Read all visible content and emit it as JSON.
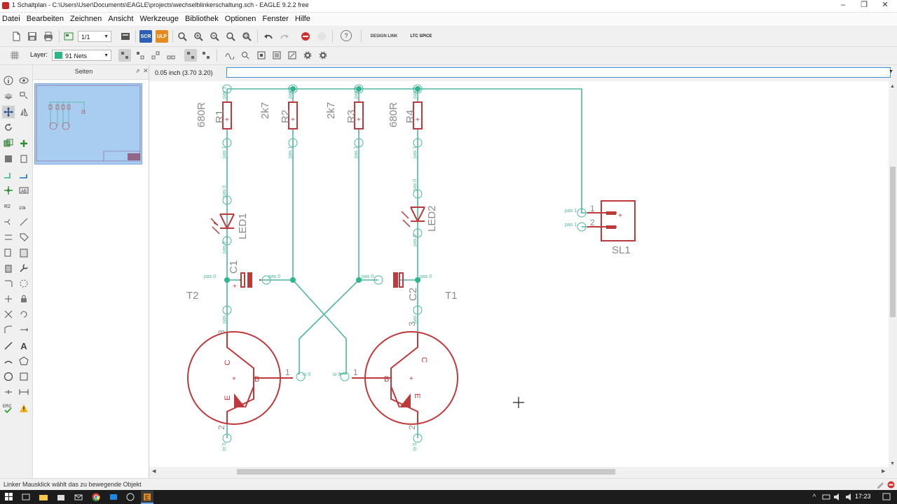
{
  "window": {
    "title": "1 Schaltplan - C:\\Users\\User\\Documents\\EAGLE\\projects\\wechselblinkerschaltung.sch - EAGLE 9.2.2 free",
    "minimize": "–",
    "maximize": "❐",
    "close": "✕"
  },
  "menu": [
    "Datei",
    "Bearbeiten",
    "Zeichnen",
    "Ansicht",
    "Werkzeuge",
    "Bibliothek",
    "Optionen",
    "Fenster",
    "Hilfe"
  ],
  "toolbar": {
    "sheet_combo": "1/1",
    "scr_label": "SCR",
    "ulp_label": "ULP",
    "help_label": "?",
    "designlink_label": "DESIGN LINK",
    "ltspice_label": "LTC SPICE",
    "layer_label": "Layer:",
    "layer_value": "91 Nets",
    "layer_color": "#2fb58a"
  },
  "pages_panel": {
    "title": "Seiten"
  },
  "coordinates": "0.05 inch (3.70 3.20)",
  "command_input": "",
  "statusbar": {
    "message": "Linker Mausklick wählt das zu bewegende Objekt"
  },
  "taskbar": {
    "time": "17:23"
  },
  "colors": {
    "net": "#4db6a0",
    "symbol": "#c0393a",
    "text": "#8a8a8a",
    "selection_panel": "#a9cdf0"
  },
  "schematic": {
    "resistors": [
      {
        "name": "R1",
        "value": "680R"
      },
      {
        "name": "R2",
        "value": "2k7"
      },
      {
        "name": "R3",
        "value": "2k7"
      },
      {
        "name": "R4",
        "value": "680R"
      }
    ],
    "leds": [
      {
        "name": "LED1"
      },
      {
        "name": "LED2"
      }
    ],
    "capacitors": [
      {
        "name": "C1"
      },
      {
        "name": "C2"
      }
    ],
    "transistors": [
      {
        "name": "T2",
        "pins": {
          "c": "C",
          "b": "B",
          "e": "E",
          "p1": "1",
          "p2": "2",
          "p3": "3"
        }
      },
      {
        "name": "T1",
        "pins": {
          "c": "C",
          "b": "B",
          "e": "E",
          "p1": "1",
          "p2": "2",
          "p3": "3"
        }
      }
    ],
    "connector": {
      "name": "SL1",
      "pin1": "1",
      "pin2": "2"
    },
    "pin_labels": {
      "pas1": "pas 1",
      "pas0": "pas 0",
      "io0": "io 0",
      "pas": "pas",
      "plus": "+"
    }
  }
}
